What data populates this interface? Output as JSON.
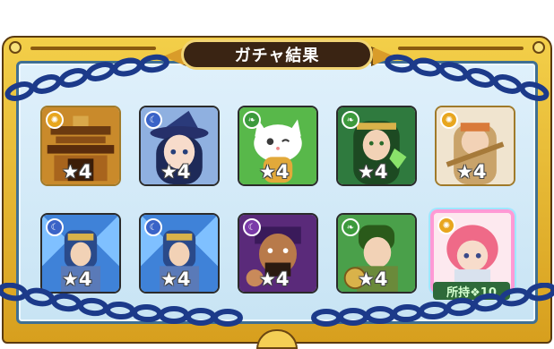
{
  "dialog": {
    "title": "ガチャ結果"
  },
  "results": [
    {
      "element": "light",
      "element_color": "#e8a61e",
      "stars": "★4",
      "art": "temple"
    },
    {
      "element": "dark",
      "element_color": "#3a63c7",
      "stars": "★4",
      "art": "witch"
    },
    {
      "element": "wood",
      "element_color": "#3c9a3c",
      "stars": "★4",
      "art": "cat"
    },
    {
      "element": "wood",
      "element_color": "#3c9a3c",
      "stars": "★4",
      "art": "priestess"
    },
    {
      "element": "light",
      "element_color": "#e8a61e",
      "stars": "★4",
      "art": "swordsman"
    },
    {
      "element": "dark",
      "element_color": "#3a63c7",
      "stars": "★4",
      "art": "knight"
    },
    {
      "element": "dark",
      "element_color": "#3a63c7",
      "stars": "★4",
      "art": "knight"
    },
    {
      "element": "dark",
      "element_color": "#7a3aa8",
      "stars": "★4",
      "art": "brawler"
    },
    {
      "element": "wood",
      "element_color": "#3c9a3c",
      "stars": "★4",
      "art": "warrior"
    },
    {
      "element": "light",
      "element_color": "#e8a61e",
      "stars": "",
      "art": "pink-hair"
    }
  ],
  "owned_badge": "所持❖10",
  "colors": {
    "frame": "#f3cf49",
    "panel": "#dff0fb",
    "title_bg": "#3a2413",
    "chain": "#1c3a8a"
  }
}
